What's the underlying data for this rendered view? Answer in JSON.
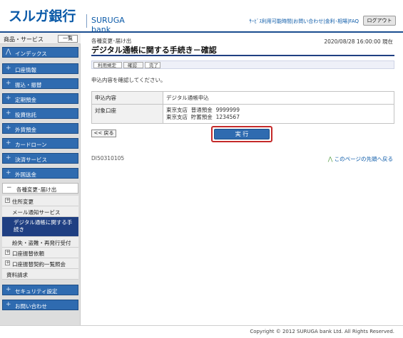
{
  "header": {
    "logo_jp": "スルガ銀行",
    "logo_en": "SURUGA bank",
    "links": "ｻｰﾋﾞｽ利用可能時間|お問い合わせ|金利･相場|FAQ",
    "logout_label": "ログアウト"
  },
  "sidebar": {
    "title": "商品・サービス",
    "list_button": "一覧",
    "items": [
      {
        "label": "インデックス"
      },
      {
        "label": "口座情報"
      },
      {
        "label": "振込・振替"
      },
      {
        "label": "定期預金"
      },
      {
        "label": "投資信託"
      },
      {
        "label": "外貨預金"
      },
      {
        "label": "カードローン"
      },
      {
        "label": "決済サービス"
      },
      {
        "label": "外国送金"
      }
    ],
    "expanded": {
      "label": "各種変更･届け出",
      "subitems": [
        {
          "label": "住所変更"
        },
        {
          "label": "メール通知サービス"
        },
        {
          "label": "デジタル通帳に関する手続き"
        },
        {
          "label": "紛失・盗難・再発行受付"
        },
        {
          "label": "口座振替依頼"
        },
        {
          "label": "口座振替契約一覧照会"
        },
        {
          "label": "資料請求"
        }
      ]
    },
    "bottom_items": [
      {
        "label": "セキュリティ設定"
      },
      {
        "label": "お問い合わせ"
      }
    ]
  },
  "main": {
    "breadcrumb": "各種変更･届け出",
    "datetime": "2020/08/28 16:00:00 現在",
    "title": "デジタル通帳に関する手続き－確認",
    "steps": [
      "利用規定",
      "確認",
      "完了"
    ],
    "instruction": "申込内容を確認してください。",
    "table": {
      "row1": {
        "label": "申込内容",
        "value": "デジタル通帳申込"
      },
      "row2": {
        "label": "対象口座",
        "accounts": [
          {
            "branch": "東京支店",
            "type": "普通預金",
            "number": "9999999"
          },
          {
            "branch": "東京支店",
            "type": "貯蓄預金",
            "number": "1234567"
          }
        ]
      }
    },
    "back_button": "<< 戻る",
    "execute_button": "実 行",
    "screen_id": "DI50310105",
    "page_top": "このページの先頭へ戻る"
  },
  "footer": {
    "copyright": "Copyright © 2012 SURUGA bank Ltd. All Rights Reserved."
  },
  "colors": {
    "brand": "#0b5aa8",
    "nav_blue": "#2f6bb0",
    "active_nav": "#1f3f82",
    "highlight": "#c42a2a"
  }
}
